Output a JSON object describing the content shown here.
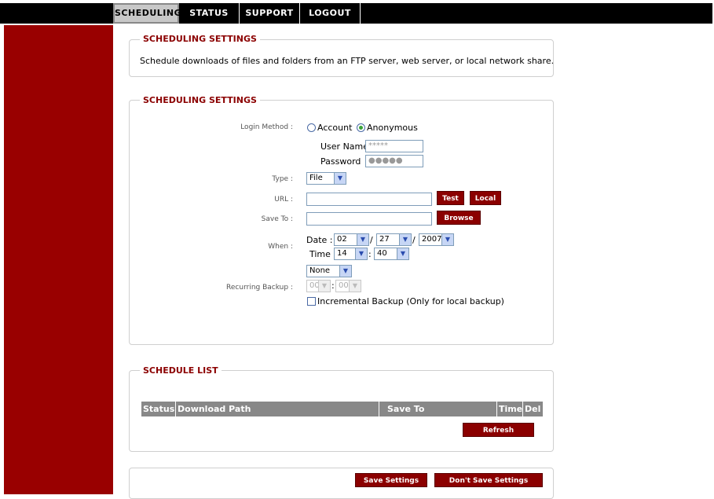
{
  "nav": {
    "tabs": [
      {
        "label": "SCHEDULING"
      },
      {
        "label": "STATUS"
      },
      {
        "label": "SUPPORT"
      },
      {
        "label": "LOGOUT"
      }
    ]
  },
  "section1": {
    "title": "SCHEDULING SETTINGS",
    "description": "Schedule downloads of files and folders from an FTP server, web server, or local network share."
  },
  "section2": {
    "title": "SCHEDULING SETTINGS",
    "login_method_label": "Login Method :",
    "account_label": "Account",
    "anonymous_label": "Anonymous",
    "username_label": "User Name",
    "username_value": "*****",
    "password_label": "Password",
    "password_value": "●●●●●",
    "type_label": "Type :",
    "type_value": "File",
    "url_label": "URL :",
    "url_value": "",
    "test_button": "Test",
    "local_button": "Local",
    "save_to_label": "Save To :",
    "save_to_value": "",
    "browse_button": "Browse",
    "when_label": "When :",
    "date_label": "Date :",
    "date_month": "02",
    "date_day": "27",
    "date_year": "2007",
    "slash": "/",
    "time_label": "Time :",
    "time_hour": "14",
    "time_minute": "40",
    "colon": ":",
    "recurring_label": "Recurring Backup :",
    "recurring_value": "None",
    "recurring_hour": "00",
    "recurring_minute": "00",
    "incremental_label": "Incremental Backup (Only for local backup)"
  },
  "schedule_list": {
    "title": "SCHEDULE LIST",
    "columns": [
      "Status",
      "Download Path",
      "Save To",
      "Time",
      "Del"
    ],
    "refresh_button": "Refresh"
  },
  "footer": {
    "save_button": "Save Settings",
    "dont_save_button": "Don't Save Settings"
  },
  "colors": {
    "accent": "#8b0000",
    "sidebar": "#990000",
    "header": "#000000"
  }
}
